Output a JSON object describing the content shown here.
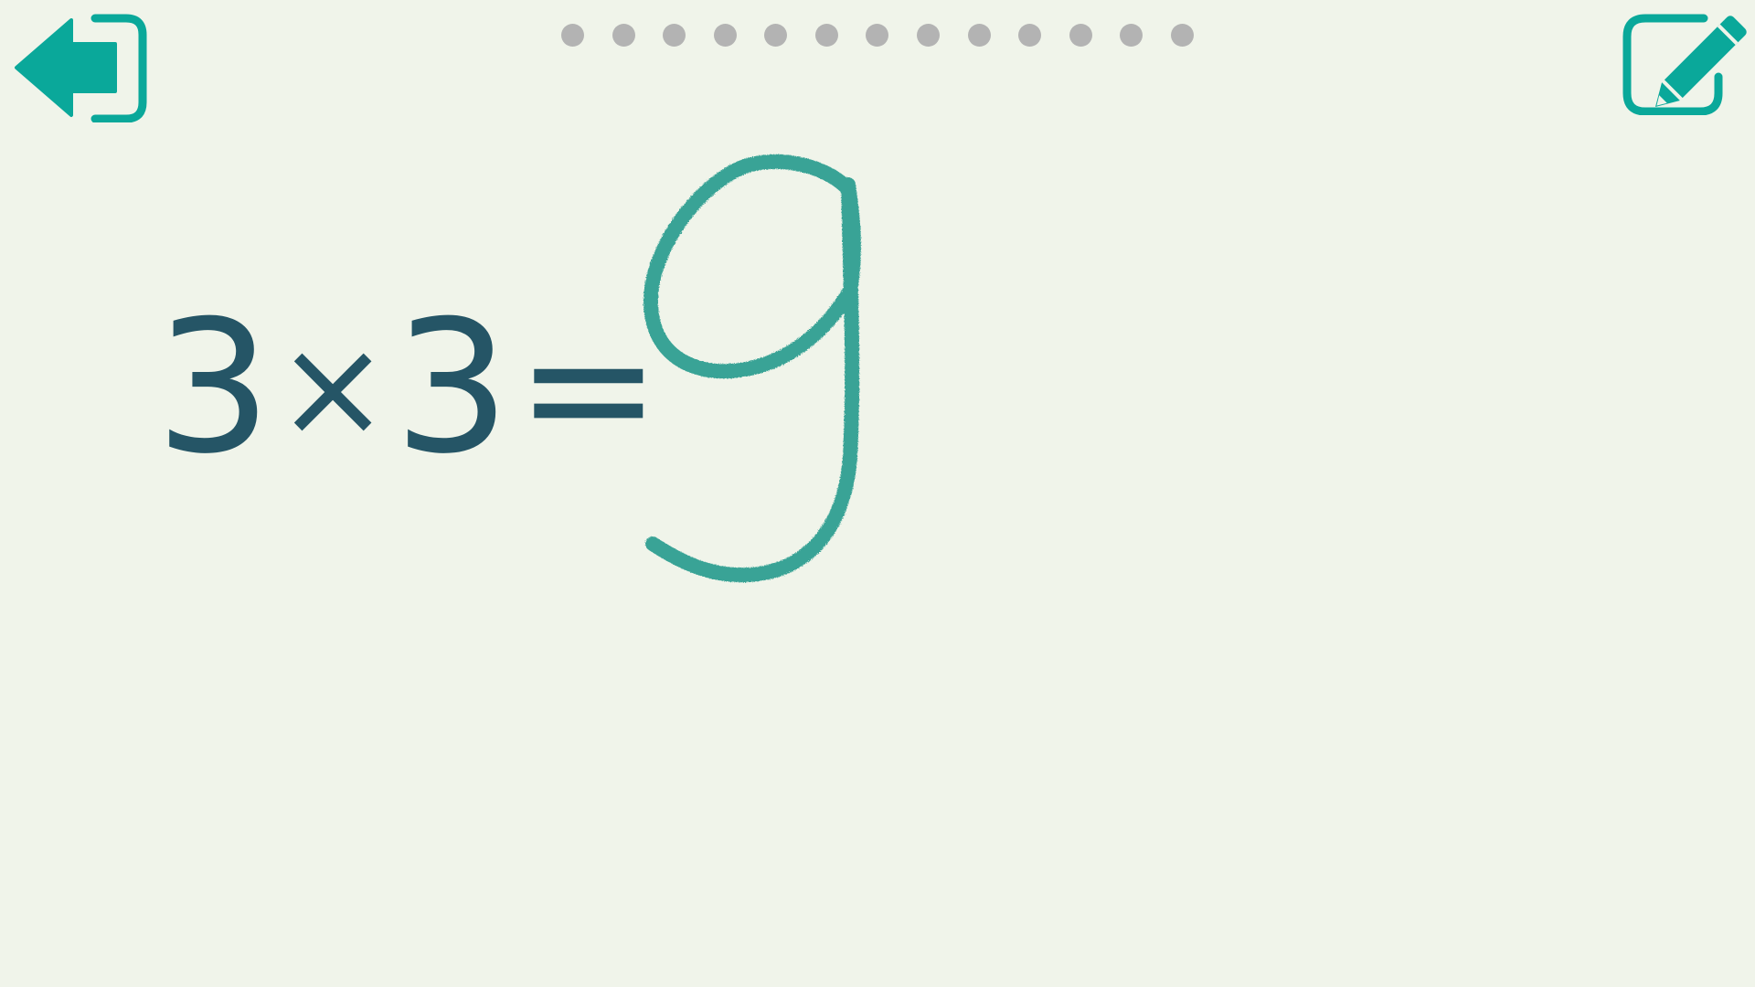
{
  "colors": {
    "background": "#f0f4ea",
    "accent": "#0aa89a",
    "equation_text": "#255566",
    "progress_dot": "#b3b3b3",
    "handwriting": "#2a9d8f"
  },
  "toolbar": {
    "exit_icon": "exit-arrow-icon",
    "edit_icon": "pencil-edit-icon"
  },
  "progress": {
    "total": 13
  },
  "equation": {
    "operand_a": "3",
    "operator": "×",
    "operand_b": "3",
    "equals": "="
  },
  "answer": {
    "handwritten_value": "9"
  }
}
